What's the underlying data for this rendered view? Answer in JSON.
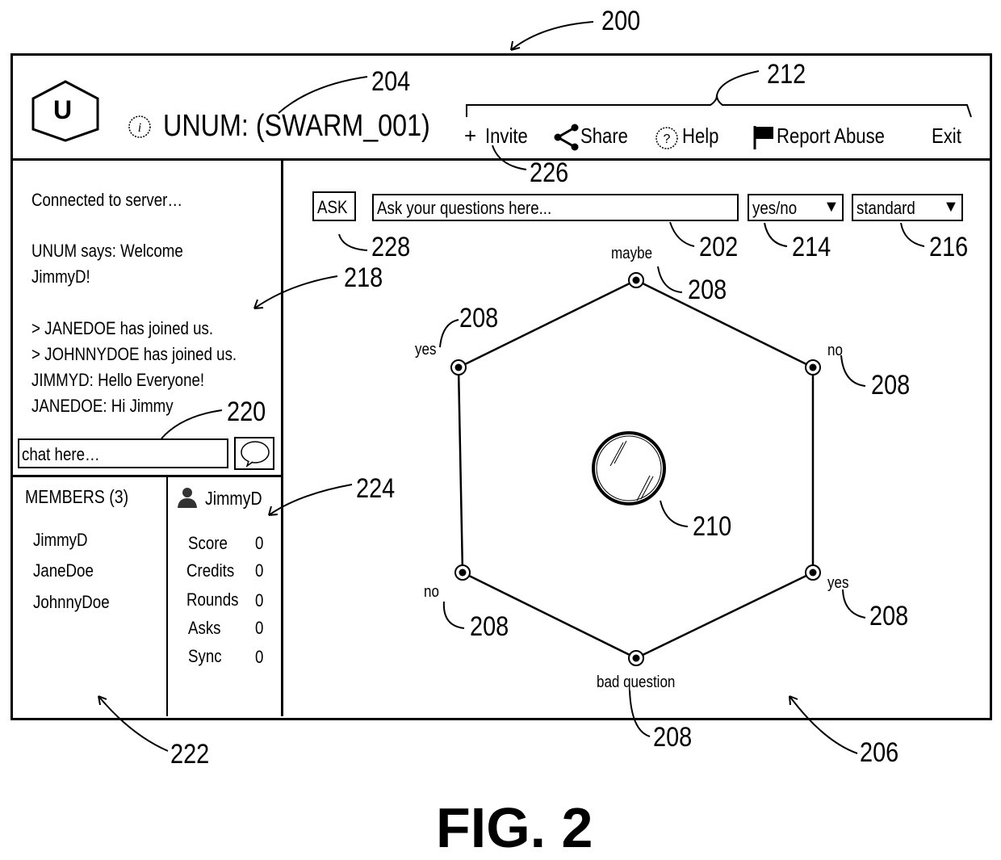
{
  "figure_label": "FIG. 2",
  "header": {
    "logo_letter": "U",
    "title": "UNUM: (SWARM_001)",
    "nav": {
      "invite": "Invite",
      "share": "Share",
      "help": "Help",
      "report_abuse": "Report Abuse",
      "exit": "Exit"
    }
  },
  "chat": {
    "messages": [
      "Connected to server…",
      "UNUM says: Welcome",
      "JimmyD!",
      "> JANEDOE has joined us.",
      "> JOHNNYDOE has joined us.",
      "JIMMYD: Hello Everyone!",
      "JANEDOE: Hi Jimmy"
    ],
    "input_placeholder": "chat here…"
  },
  "members": {
    "title": "MEMBERS (3)",
    "list": [
      "JimmyD",
      "JaneDoe",
      "JohnnyDoe"
    ]
  },
  "profile": {
    "username": "JimmyD",
    "stats": [
      {
        "label": "Score",
        "value": "0"
      },
      {
        "label": "Credits",
        "value": "0"
      },
      {
        "label": "Rounds",
        "value": "0"
      },
      {
        "label": "Asks",
        "value": "0"
      },
      {
        "label": "Sync",
        "value": "0"
      }
    ]
  },
  "question_bar": {
    "ask_label": "ASK",
    "input_placeholder": "Ask your questions here...",
    "type_select": "yes/no",
    "mode_select": "standard"
  },
  "board": {
    "answers": [
      "maybe",
      "no",
      "yes",
      "bad question",
      "no",
      "yes"
    ]
  },
  "reference_numerals": {
    "r200": "200",
    "r202": "202",
    "r204": "204",
    "r206": "206",
    "r208": "208",
    "r210": "210",
    "r212": "212",
    "r214": "214",
    "r216": "216",
    "r218": "218",
    "r220": "220",
    "r222": "222",
    "r224": "224",
    "r226": "226",
    "r228": "228"
  }
}
